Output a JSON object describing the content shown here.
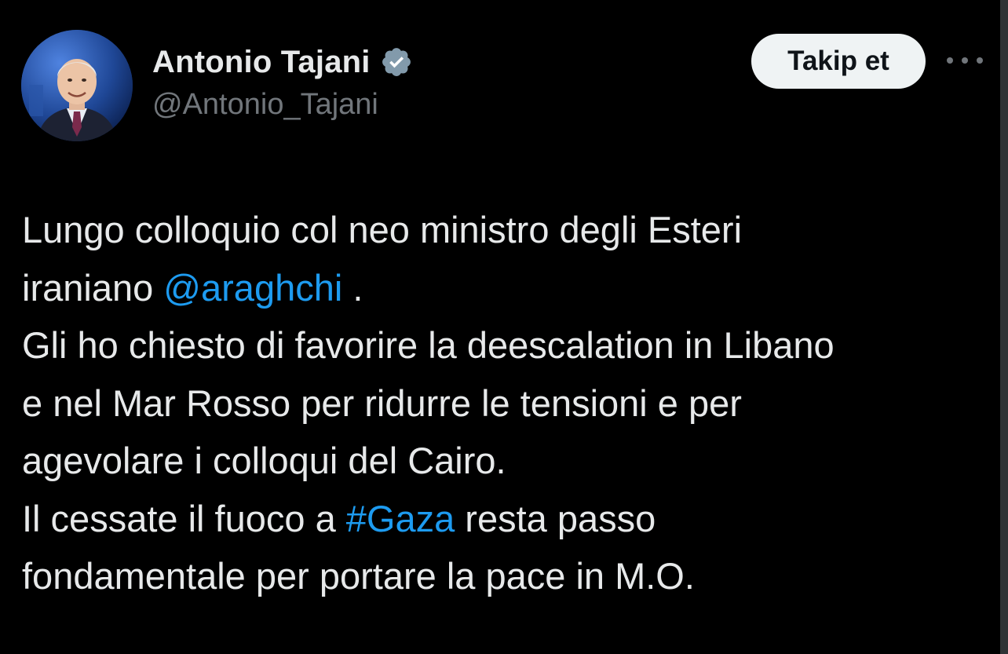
{
  "author": {
    "display_name": "Antonio Tajani",
    "handle": "@Antonio_Tajani",
    "verified": true,
    "verified_icon": "verified-badge-icon",
    "avatar_icon": "profile-photo"
  },
  "header": {
    "follow_label": "Takip et",
    "more_icon": "more-options-icon"
  },
  "tweet": {
    "line1": "Lungo colloquio col neo ministro degli Esteri",
    "line2_pre": "iraniano ",
    "mention": "@araghchi",
    "line2_post": " .",
    "line3": "Gli ho chiesto di favorire la deescalation in Libano",
    "line4": "e nel Mar Rosso per ridurre le tensioni e per",
    "line5": "agevolare i colloqui del Cairo.",
    "line6_pre": "Il cessate il fuoco a ",
    "hashtag": "#Gaza",
    "line6_post": " resta passo",
    "line7": "fondamentale per portare la pace in M.O."
  },
  "colors": {
    "background": "#000000",
    "text": "#e7e9ea",
    "secondary": "#71767b",
    "link": "#1d9bf0",
    "button_bg": "#eff3f4",
    "verified": "#829aab"
  }
}
